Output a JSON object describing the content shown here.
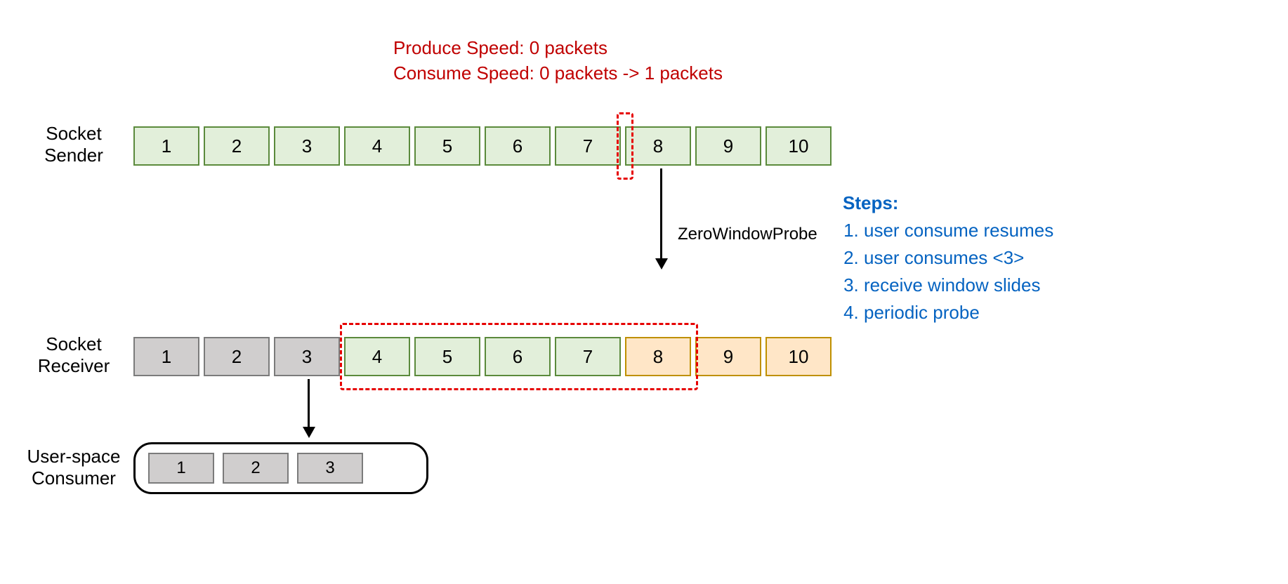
{
  "speed": {
    "produce": "Produce Speed:    0 packets",
    "consume": "Consume Speed:  0 packets -> 1 packets"
  },
  "labels": {
    "sender_l1": "Socket",
    "sender_l2": "Sender",
    "receiver_l1": "Socket",
    "receiver_l2": "Receiver",
    "consumer_l1": "User-space",
    "consumer_l2": "Consumer"
  },
  "sender_cells": [
    "1",
    "2",
    "3",
    "4",
    "5",
    "6",
    "7",
    "8",
    "9",
    "10"
  ],
  "receiver_cells": [
    "1",
    "2",
    "3",
    "4",
    "5",
    "6",
    "7",
    "8",
    "9",
    "10"
  ],
  "receiver_colors": [
    "grey",
    "grey",
    "grey",
    "green",
    "green",
    "green",
    "green",
    "orange",
    "orange",
    "orange"
  ],
  "consumer_cells": [
    "1",
    "2",
    "3"
  ],
  "probe_label": "ZeroWindowProbe",
  "steps": {
    "title": "Steps:",
    "items": [
      "user consume resumes",
      "user consumes <3>",
      "receive window slides",
      "periodic probe"
    ]
  }
}
